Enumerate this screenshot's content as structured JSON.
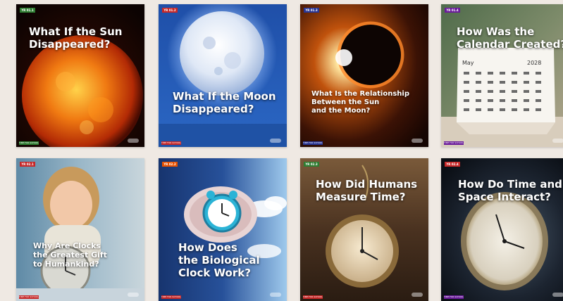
{
  "cards": [
    {
      "tag": "YR 01.1",
      "tag_color": "#2e7d32",
      "footer": "TIME FOR SCHOOL",
      "footer_color": "#2e7d32",
      "icon": "sun-icon",
      "title": "What If the Sun\nDisappeared?"
    },
    {
      "tag": "YR 01.2",
      "tag_color": "#c62828",
      "footer": "TIME FOR SCHOOL",
      "footer_color": "#c62828",
      "icon": "moon-icon",
      "title": "What If the Moon\nDisappeared?"
    },
    {
      "tag": "YR 01.3",
      "tag_color": "#283593",
      "footer": "TIME FOR SCHOOL",
      "footer_color": "#283593",
      "icon": "eclipse-icon",
      "title": "What Is the Relationship\nBetween the Sun\nand the Moon?"
    },
    {
      "tag": "YR 01.4",
      "tag_color": "#6a1b9a",
      "footer": "TIME FOR SCHOOL",
      "footer_color": "#6a1b9a",
      "icon": "calendar-icon",
      "title": "How Was the\nCalendar Created?",
      "cal_month": "May",
      "cal_year": "2028"
    },
    {
      "tag": "YR 02.1",
      "tag_color": "#c62828",
      "footer": "TIME FOR SCHOOL",
      "footer_color": "#c62828",
      "icon": "child-clock-icon",
      "title": "Why Are Clocks\nthe Greatest Gift\nto Humankind?"
    },
    {
      "tag": "YR 02.2",
      "tag_color": "#e65100",
      "footer": "TIME FOR SCHOOL",
      "footer_color": "#c62828",
      "icon": "brain-clock-icon",
      "title": "How Does\nthe Biological\nClock Work?"
    },
    {
      "tag": "YR 02.3",
      "tag_color": "#2e7d32",
      "footer": "TIME FOR SCHOOL",
      "footer_color": "#c62828",
      "icon": "pocket-watch-icon",
      "title": "How Did Humans\nMeasure Time?"
    },
    {
      "tag": "YR 02.4",
      "tag_color": "#c62828",
      "footer": "TIME FOR SCHOOL",
      "footer_color": "#6a1b9a",
      "icon": "space-clock-icon",
      "title": "How Do Time and\nSpace Interact?"
    }
  ]
}
